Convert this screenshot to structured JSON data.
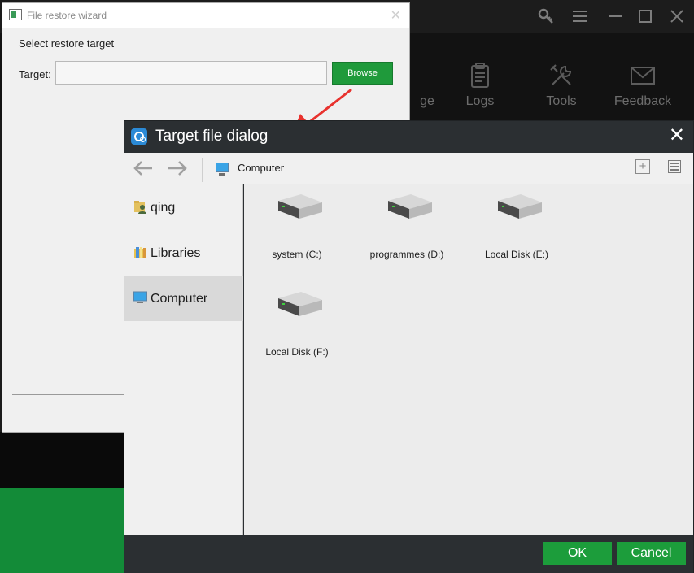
{
  "background_app": {
    "nav_items": [
      {
        "label": "ge",
        "icon": "shield-icon"
      },
      {
        "label": "Logs",
        "icon": "clipboard-icon"
      },
      {
        "label": "Tools",
        "icon": "tools-icon"
      },
      {
        "label": "Feedback",
        "icon": "mail-icon"
      }
    ],
    "window_controls": [
      "key-icon",
      "menu-icon",
      "maximize-icon",
      "close-icon"
    ]
  },
  "wizard": {
    "title": "File restore wizard",
    "heading": "Select restore target",
    "target_label": "Target:",
    "target_value": "",
    "browse_label": "Browse"
  },
  "dialog": {
    "title": "Target file dialog",
    "toolbar": {
      "location": "Computer"
    },
    "sidebar": [
      {
        "label": "qing",
        "icon": "user-folder-icon",
        "active": false
      },
      {
        "label": "Libraries",
        "icon": "libraries-icon",
        "active": false
      },
      {
        "label": "Computer",
        "icon": "computer-icon",
        "active": true
      }
    ],
    "drives": [
      {
        "label": "system (C:)"
      },
      {
        "label": "programmes (D:)"
      },
      {
        "label": "Local Disk (E:)"
      },
      {
        "label": "Local Disk (F:)"
      }
    ],
    "ok_label": "OK",
    "cancel_label": "Cancel"
  },
  "colors": {
    "accent_green": "#1c9d3b",
    "dialog_dark": "#2b2f32",
    "annotation_red": "#e8322e"
  }
}
